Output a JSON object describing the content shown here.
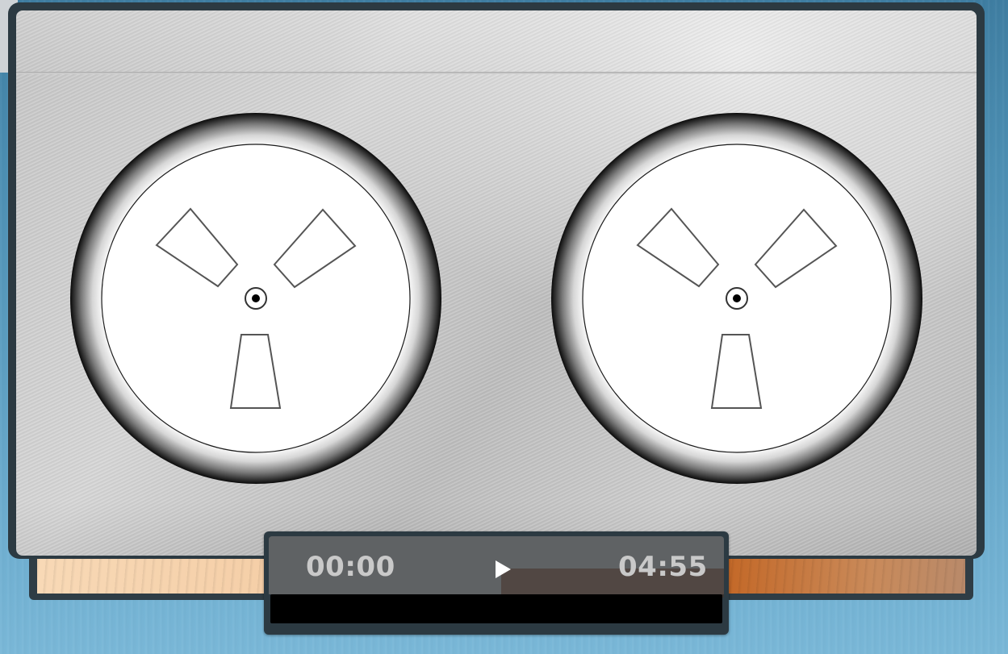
{
  "player": {
    "elapsed_time": "00:00",
    "total_time": "04:55",
    "progress_fraction": 0,
    "play_icon": "play-icon",
    "reel_icon": "tape-reel-icon"
  },
  "colors": {
    "background": "#5d9fc2",
    "panel_frame": "#2c3a42",
    "panel_metal": "#c6c6c6",
    "time_text": "#c9c9c9",
    "progress_track": "#000000"
  }
}
